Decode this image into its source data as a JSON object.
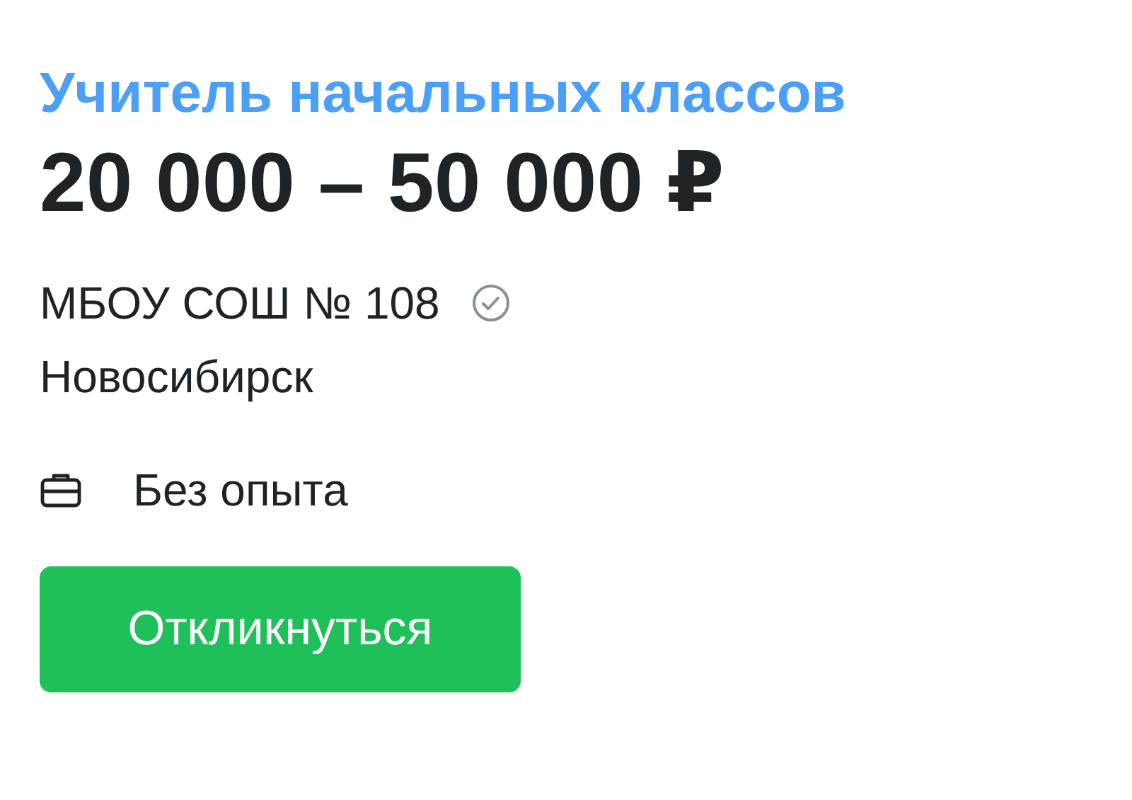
{
  "vacancy": {
    "title": "Учитель начальных классов",
    "salary": "20 000 – 50 000 ₽",
    "company": "МБОУ СОШ № 108",
    "company_verified": true,
    "city": "Новосибирск",
    "experience": "Без опыта"
  },
  "button": {
    "label": "Откликнуться"
  }
}
